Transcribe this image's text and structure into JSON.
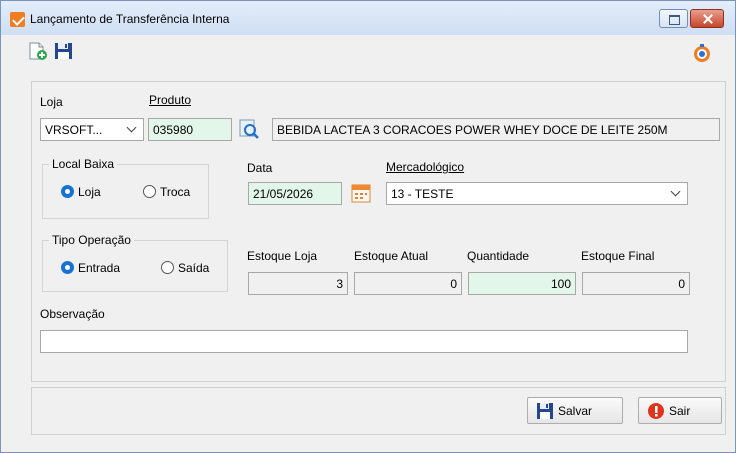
{
  "window": {
    "title": "Lançamento de Transferência Interna"
  },
  "toolbar": {
    "new_icon": "new-document-icon",
    "save_icon": "floppy-disk-icon",
    "timer_icon": "timer-icon"
  },
  "form": {
    "loja_label": "Loja",
    "loja_value": "VRSOFT...",
    "produto_label": "Produto",
    "produto_code": "035980",
    "produto_description": "BEBIDA LACTEA  3 CORACOES POWER WHEY DOCE DE LEITE 250M",
    "local_baixa": {
      "title": "Local Baixa",
      "options": [
        "Loja",
        "Troca"
      ],
      "selected": "Loja"
    },
    "tipo_operacao": {
      "title": "Tipo Operação",
      "options": [
        "Entrada",
        "Saída"
      ],
      "selected": "Entrada"
    },
    "data_label": "Data",
    "data_value": "21/05/2026",
    "mercadologico_label": "Mercadológico",
    "mercadologico_value": "13 - TESTE",
    "estoque_loja_label": "Estoque Loja",
    "estoque_loja_value": "3",
    "estoque_atual_label": "Estoque Atual",
    "estoque_atual_value": "0",
    "quantidade_label": "Quantidade",
    "quantidade_value": "100",
    "estoque_final_label": "Estoque Final",
    "estoque_final_value": "0",
    "observacao_label": "Observação",
    "observacao_value": ""
  },
  "footer": {
    "save_label": "Salvar",
    "exit_label": "Sair"
  },
  "colors": {
    "accent_green_field": "#e3f6ea",
    "radio_selected": "#1673d6",
    "exit_red": "#e0341c",
    "app_icon_orange": "#f07e21"
  }
}
